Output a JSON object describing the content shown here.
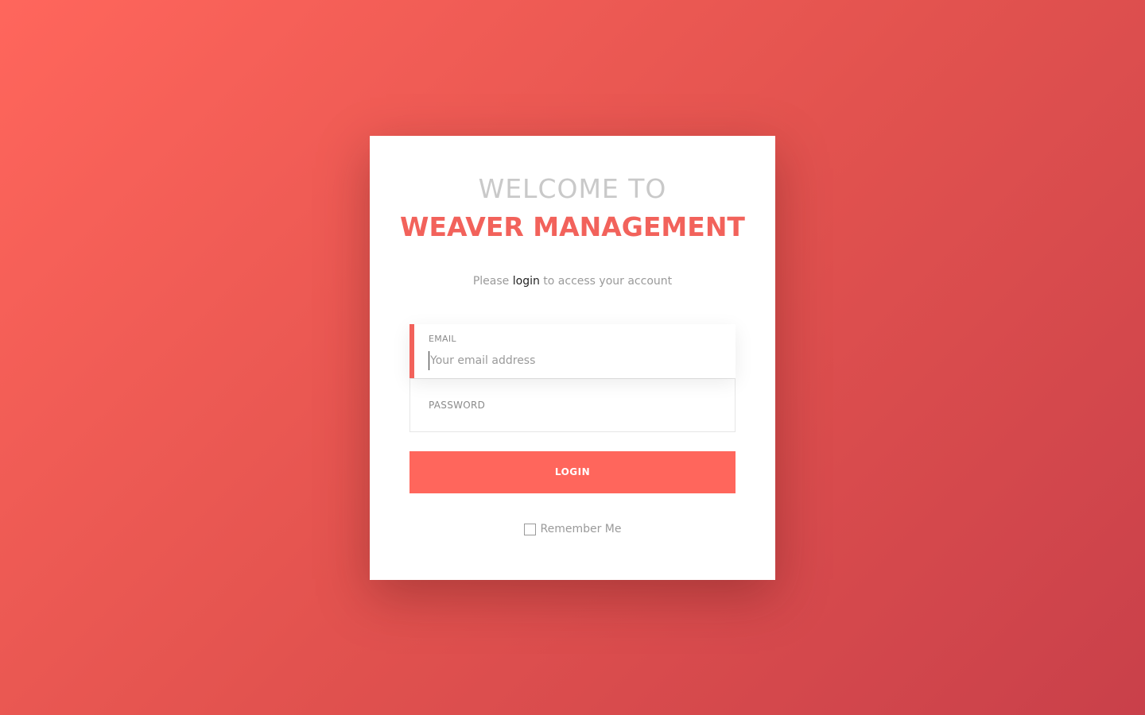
{
  "header": {
    "welcome_line": "WELCOME TO",
    "app_name": "WEAVER MANAGEMENT"
  },
  "subtitle": {
    "prefix": "Please",
    "link": "login",
    "suffix": "to access your account"
  },
  "email": {
    "label": "EMAIL",
    "placeholder": "Your email address",
    "value": ""
  },
  "password": {
    "label": "PASSWORD",
    "value": ""
  },
  "login_button": {
    "label": "LOGIN"
  },
  "remember": {
    "label": "Remember Me",
    "checked": false
  },
  "colors": {
    "accent": "#ff665c",
    "background_start": "#ff665c",
    "background_end": "#c9404a",
    "title_muted": "#c9c9c9"
  }
}
